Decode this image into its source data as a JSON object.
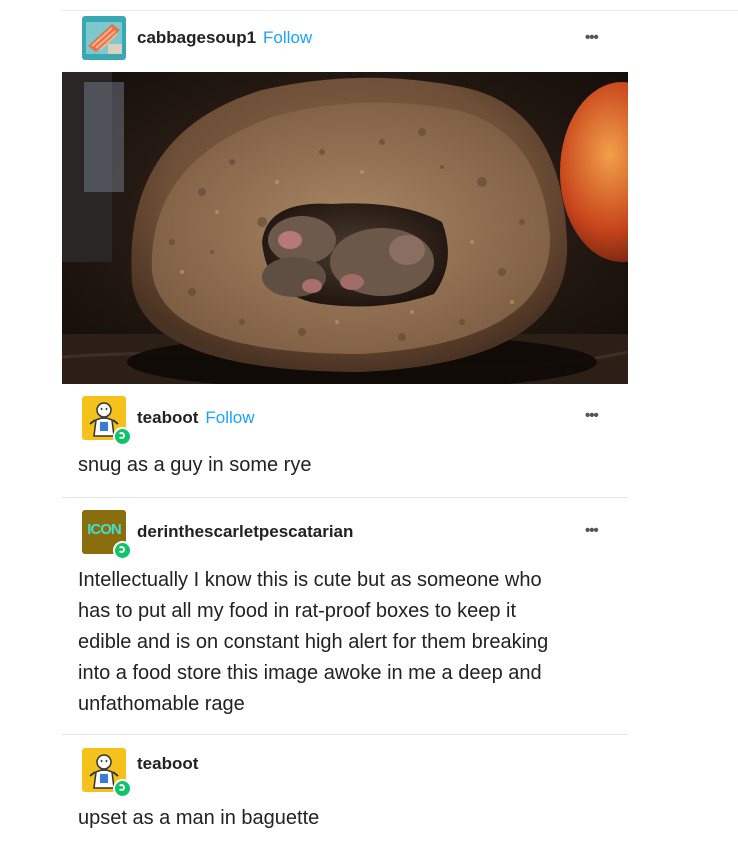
{
  "post": {
    "author": "cabbagesoup1",
    "follow_label": "Follow",
    "more_label": "•••",
    "photo_icon": "bread-with-mice-photo"
  },
  "replies": [
    {
      "author": "teaboot",
      "follow_label": "Follow",
      "more_label": "•••",
      "text": "snug as a guy in some rye"
    },
    {
      "author": "derinthescarletpescatarian",
      "avatar_label": "ICON",
      "more_label": "•••",
      "text_lines": [
        "Intellectually I know this is cute but as someone who",
        "has to put all my food in rat-proof boxes to keep it",
        "edible and is on constant high alert for them breaking",
        "into a food store this image awoke in me a deep and",
        "unfathomable rage"
      ]
    },
    {
      "author": "teaboot",
      "text": "upset as a man in baguette"
    }
  ],
  "colors": {
    "follow": "#1aa2ff",
    "reblog_badge": "#10c46a",
    "teaboot_avatar": "#f5c21b",
    "icon_avatar": "#8a6d0c"
  }
}
